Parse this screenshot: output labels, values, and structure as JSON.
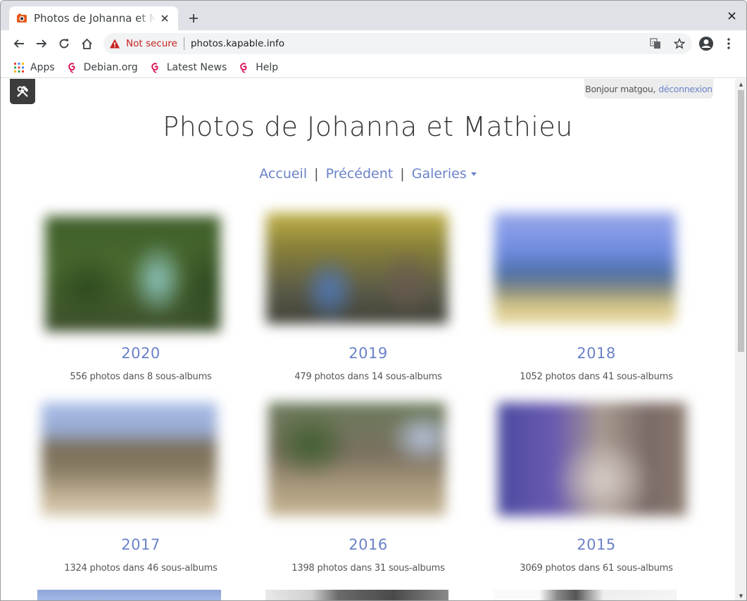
{
  "browser": {
    "tab_title": "Photos de Johanna et Mathieu",
    "security_label": "Not secure",
    "url": "photos.kapable.info",
    "bookmarks": [
      {
        "label": "Apps",
        "icon": "apps-grid-icon"
      },
      {
        "label": "Debian.org",
        "icon": "debian-swirl-icon"
      },
      {
        "label": "Latest News",
        "icon": "debian-swirl-icon"
      },
      {
        "label": "Help",
        "icon": "debian-swirl-icon"
      }
    ]
  },
  "page": {
    "greeting_text": "Bonjour matgou,",
    "logout_label": "déconnexion",
    "title": "Photos de Johanna et Mathieu",
    "nav": {
      "home": "Accueil",
      "previous": "Précédent",
      "galleries": "Galeries",
      "separator": "|"
    },
    "albums": [
      {
        "year": "2020",
        "stats": "556 photos dans 8 sous-albums"
      },
      {
        "year": "2019",
        "stats": "479 photos dans 14 sous-albums"
      },
      {
        "year": "2018",
        "stats": "1052 photos dans 41 sous-albums"
      },
      {
        "year": "2017",
        "stats": "1324 photos dans 46 sous-albums"
      },
      {
        "year": "2016",
        "stats": "1398 photos dans 31 sous-albums"
      },
      {
        "year": "2015",
        "stats": "3069 photos dans 61 sous-albums"
      }
    ]
  },
  "colors": {
    "link": "#6b82c9",
    "title": "#333333",
    "admin_button": "#3c3c3c",
    "not_secure": "#c5221f"
  }
}
